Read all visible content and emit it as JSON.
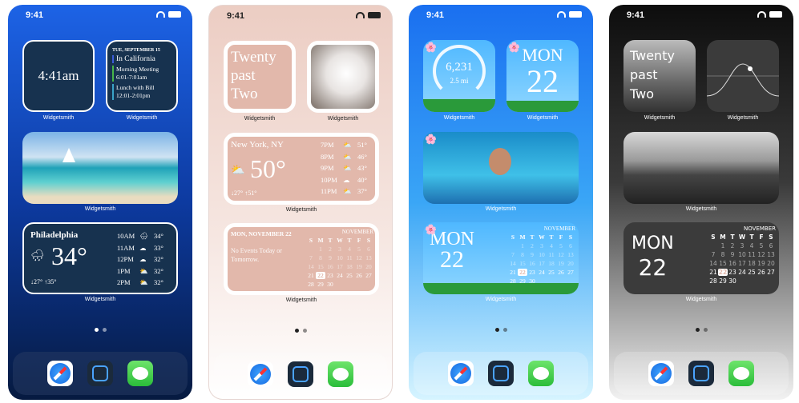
{
  "status_time": "9:41",
  "app_label": "Widgetsmith",
  "phone1": {
    "clock": "4:41am",
    "calendar": {
      "date": "TUE, SEPTEMBER 15",
      "events": [
        {
          "title": "In California",
          "time": "",
          "color": "#3b5bd9"
        },
        {
          "title": "Morning Meeting",
          "time": "6:01-7:01am",
          "color": "#47b548"
        },
        {
          "title": "Lunch with Bill",
          "time": "12:01-2:01pm",
          "color": "#3aa3c8"
        }
      ]
    },
    "weather": {
      "city": "Philadelphia",
      "temp": "34°",
      "low": "↓27°",
      "high": "↑35°",
      "hours": [
        [
          "10AM",
          "🌨",
          "34°"
        ],
        [
          "11AM",
          "☁",
          "33°"
        ],
        [
          "12PM",
          "☁",
          "32°"
        ],
        [
          "1PM",
          "⛅",
          "32°"
        ],
        [
          "2PM",
          "⛅",
          "32°"
        ]
      ]
    }
  },
  "phone2": {
    "time_words": [
      "Twenty",
      "past",
      "Two"
    ],
    "weather": {
      "city": "New York, NY",
      "temp": "50°",
      "low": "↓27°",
      "high": "↑51°",
      "hours": [
        [
          "7PM",
          "⛅",
          "51°"
        ],
        [
          "8PM",
          "⛅",
          "46°"
        ],
        [
          "9PM",
          "⛅",
          "43°"
        ],
        [
          "10PM",
          "☁",
          "40°"
        ],
        [
          "11PM",
          "⛅",
          "37°"
        ]
      ]
    },
    "calendar": {
      "date": "MON, NOVEMBER 22",
      "no_events": "No Events Today or Tomorrow."
    }
  },
  "phone3": {
    "steps": "6,231",
    "distance": "2.5 mi",
    "day": "MON",
    "date": "22"
  },
  "phone4": {
    "time_words": [
      "Twenty",
      "past",
      "Two"
    ],
    "day": "MON",
    "date": "22"
  },
  "month": {
    "name": "NOVEMBER",
    "weekdays": [
      "S",
      "M",
      "T",
      "W",
      "T",
      "F",
      "S"
    ],
    "start_offset": 1,
    "days": 30,
    "today": 22
  },
  "dock": [
    "safari-icon",
    "widgetsmith-icon",
    "messages-icon"
  ],
  "colors": {
    "phone1": "#1d63e6",
    "phone2": "#eccdc3",
    "phone3": "#1a6ff0",
    "phone4": "#0d0d0d"
  }
}
